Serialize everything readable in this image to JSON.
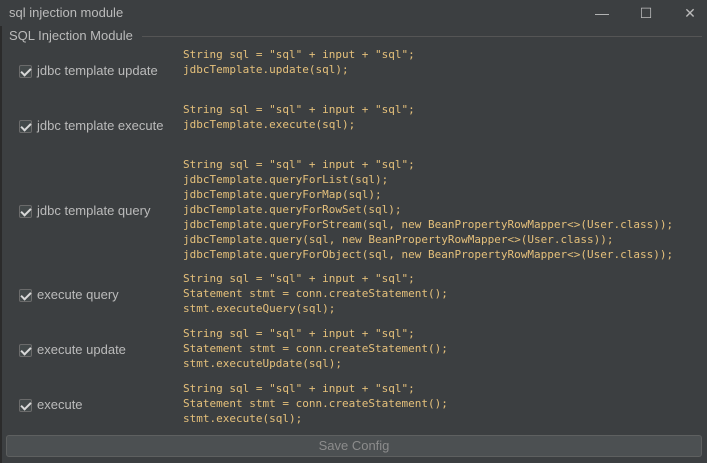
{
  "window": {
    "title": "sql injection module",
    "controls": {
      "minimize": "—",
      "maximize": "☐",
      "close": "✕"
    }
  },
  "group": {
    "title": "SQL Injection Module"
  },
  "options": [
    {
      "label": "jdbc template update",
      "checked": true,
      "code": "String sql = \"sql\" + input + \"sql\";\njdbcTemplate.update(sql);"
    },
    {
      "label": "jdbc template execute",
      "checked": true,
      "code": "String sql = \"sql\" + input + \"sql\";\njdbcTemplate.execute(sql);"
    },
    {
      "label": "jdbc template query",
      "checked": true,
      "code": "String sql = \"sql\" + input + \"sql\";\njdbcTemplate.queryForList(sql);\njdbcTemplate.queryForMap(sql);\njdbcTemplate.queryForRowSet(sql);\njdbcTemplate.queryForStream(sql, new BeanPropertyRowMapper<>(User.class));\njdbcTemplate.query(sql, new BeanPropertyRowMapper<>(User.class));\njdbcTemplate.queryForObject(sql, new BeanPropertyRowMapper<>(User.class));"
    },
    {
      "label": "execute query",
      "checked": true,
      "code": "String sql = \"sql\" + input + \"sql\";\nStatement stmt = conn.createStatement();\nstmt.executeQuery(sql);"
    },
    {
      "label": "execute update",
      "checked": true,
      "code": "String sql = \"sql\" + input + \"sql\";\nStatement stmt = conn.createStatement();\nstmt.executeUpdate(sql);"
    },
    {
      "label": "execute",
      "checked": true,
      "code": "String sql = \"sql\" + input + \"sql\";\nStatement stmt = conn.createStatement();\nstmt.execute(sql);"
    }
  ],
  "footer": {
    "save_label": "Save Config"
  },
  "colors": {
    "background": "#3c3f41",
    "code_text": "#e5c07b",
    "label_text": "#bbbbbb"
  }
}
